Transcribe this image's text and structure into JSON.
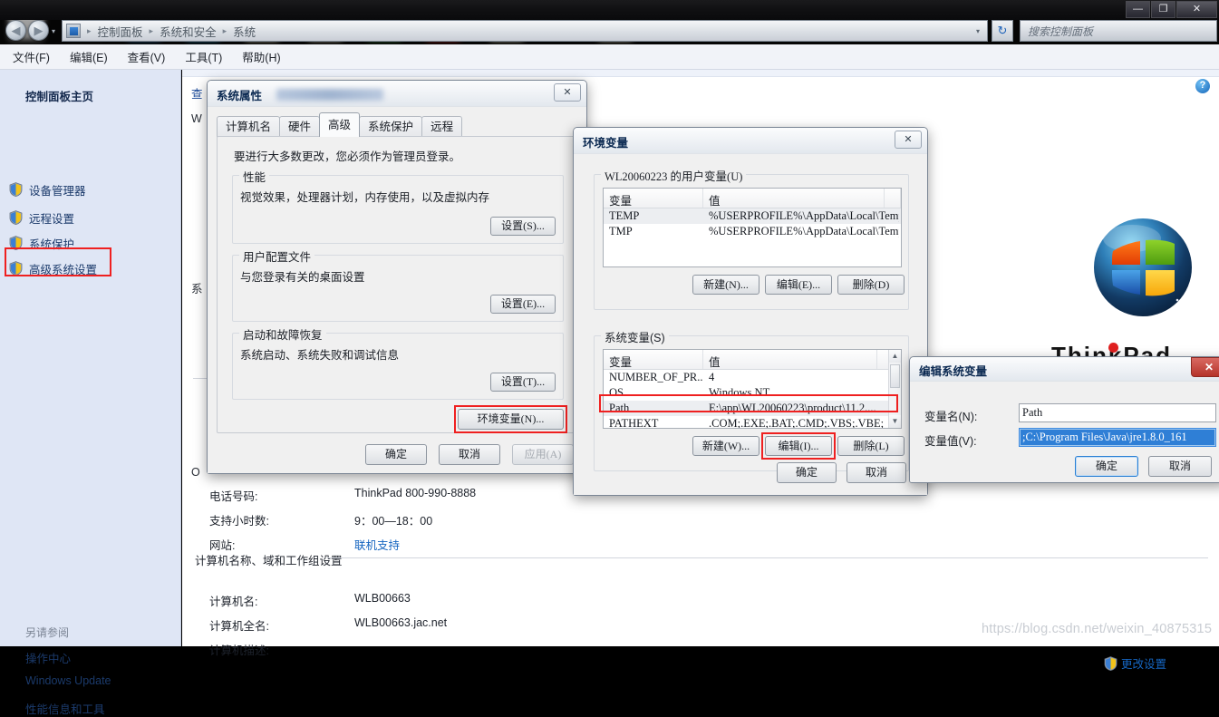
{
  "window": {
    "buttons": {
      "minimize": "—",
      "maximize": "❐",
      "close": "✕"
    }
  },
  "addressbar": {
    "back_icon": "◀",
    "forward_icon": "▶",
    "dropdown_icon": "▾",
    "crumbs": [
      "控制面板",
      "系统和安全",
      "系统"
    ],
    "separator": "▸",
    "crumb_dropdown": "▾",
    "refresh_icon": "↻",
    "search_placeholder": "搜索控制面板"
  },
  "menubar": {
    "items": [
      "文件(F)",
      "编辑(E)",
      "查看(V)",
      "工具(T)",
      "帮助(H)"
    ]
  },
  "sidebar": {
    "home": "控制面板主页",
    "items": [
      {
        "label": "设备管理器",
        "icon": "shield-icon"
      },
      {
        "label": "远程设置",
        "icon": "shield-icon"
      },
      {
        "label": "系统保护",
        "icon": "shield-icon"
      },
      {
        "label": "高级系统设置",
        "icon": "shield-icon"
      }
    ],
    "see_also_heading": "另请参阅",
    "see_also": [
      "操作中心",
      "Windows Update",
      "性能信息和工具"
    ]
  },
  "content": {
    "help_icon": "?",
    "ghost_left": [
      "查",
      "W",
      "系",
      "O"
    ],
    "support_rows": [
      {
        "label": "电话号码:",
        "value": "ThinkPad 800-990-8888",
        "link": false
      },
      {
        "label": "支持小时数:",
        "value": "9：00—18：00",
        "link": false
      },
      {
        "label": "网站:",
        "value": "联机支持",
        "link": true
      }
    ],
    "group_heading": "计算机名称、域和工作组设置",
    "computer_rows": [
      {
        "label": "计算机名:",
        "value": "WLB00663"
      },
      {
        "label": "计算机全名:",
        "value": "WLB00663.jac.net"
      },
      {
        "label": "计算机描述:",
        "value": ""
      }
    ],
    "change_settings": "更改设置",
    "thinkpad_logo": "ThinkPad",
    "watermark": "https://blog.csdn.net/weixin_40875315"
  },
  "system_properties": {
    "title": "系统属性",
    "close": "✕",
    "tabs": [
      {
        "label": "计算机名",
        "active": false
      },
      {
        "label": "硬件",
        "active": false
      },
      {
        "label": "高级",
        "active": true
      },
      {
        "label": "系统保护",
        "active": false
      },
      {
        "label": "远程",
        "active": false
      }
    ],
    "notice": "要进行大多数更改，您必须作为管理员登录。",
    "groups": [
      {
        "label": "性能",
        "desc": "视觉效果，处理器计划，内存使用，以及虚拟内存",
        "button": "设置(S)..."
      },
      {
        "label": "用户配置文件",
        "desc": "与您登录有关的桌面设置",
        "button": "设置(E)..."
      },
      {
        "label": "启动和故障恢复",
        "desc": "系统启动、系统失败和调试信息",
        "button": "设置(T)..."
      }
    ],
    "env_button": "环境变量(N)...",
    "footer_buttons": [
      {
        "label": "确定",
        "disabled": false
      },
      {
        "label": "取消",
        "disabled": false
      },
      {
        "label": "应用(A)",
        "disabled": true
      }
    ]
  },
  "env_dialog": {
    "title": "环境变量",
    "close": "✕",
    "user_group_label": "WL20060223 的用户变量(U)",
    "columns": [
      "变量",
      "值"
    ],
    "user_vars": [
      {
        "name": "TEMP",
        "value": "%USERPROFILE%\\AppData\\Local\\Temp",
        "selected": true
      },
      {
        "name": "TMP",
        "value": "%USERPROFILE%\\AppData\\Local\\Temp",
        "selected": false
      }
    ],
    "user_buttons": [
      "新建(N)...",
      "编辑(E)...",
      "删除(D)"
    ],
    "system_group_label": "系统变量(S)",
    "system_vars": [
      {
        "name": "NUMBER_OF_PR...",
        "value": "4",
        "highlight": false
      },
      {
        "name": "OS",
        "value": "Windows NT",
        "highlight": false
      },
      {
        "name": "Path",
        "value": "E:\\app\\WL20060223\\product\\11.2....",
        "highlight": true
      },
      {
        "name": "PATHEXT",
        "value": ".COM;.EXE;.BAT;.CMD;.VBS;.VBE;",
        "highlight": false
      }
    ],
    "system_buttons": [
      "新建(W)...",
      "编辑(I)...",
      "删除(L)"
    ],
    "system_button_highlight_index": 1,
    "footer_buttons": [
      "确定",
      "取消"
    ],
    "scroll_up": "▲",
    "scroll_down": "▼"
  },
  "edit_var_dialog": {
    "title": "编辑系统变量",
    "close": "✕",
    "name_label": "变量名(N):",
    "name_value": "Path",
    "value_label": "变量值(V):",
    "value_value": ";C:\\Program Files\\Java\\jre1.8.0_161",
    "buttons": [
      {
        "label": "确定",
        "default": true
      },
      {
        "label": "取消",
        "default": false
      }
    ]
  },
  "colors": {
    "accent_blue": "#1565c0",
    "highlight_red": "#ef2020",
    "sidebar_bg": "#dfe6f5",
    "selection_blue": "#2f7fd6"
  }
}
